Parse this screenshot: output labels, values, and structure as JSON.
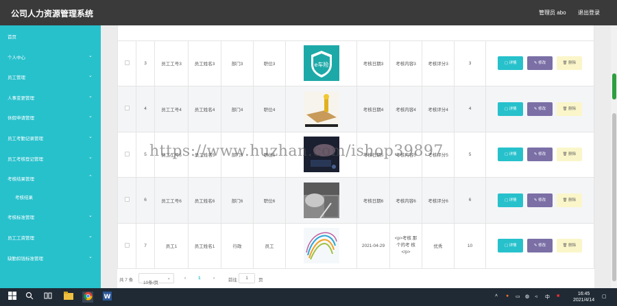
{
  "app": {
    "title": "公司人力资源管理系统",
    "user_label": "管理员 abo",
    "logout_label": "退出登录"
  },
  "sidebar": {
    "items": [
      {
        "label": "首页",
        "chevron": ""
      },
      {
        "label": "个人中心",
        "chevron": "⌄"
      },
      {
        "label": "员工管理",
        "chevron": "⌄"
      },
      {
        "label": "人事变更管理",
        "chevron": "⌄"
      },
      {
        "label": "休假申请管理",
        "chevron": "⌄"
      },
      {
        "label": "员工考勤记录管理",
        "chevron": "⌄"
      },
      {
        "label": "员工考核登记管理",
        "chevron": "⌄"
      },
      {
        "label": "考核结果管理",
        "chevron": "⌃"
      },
      {
        "label": "考核结果",
        "chevron": ""
      },
      {
        "label": "考核标准管理",
        "chevron": "⌄"
      },
      {
        "label": "员工工资管理",
        "chevron": "⌄"
      },
      {
        "label": "缺勤扣钱标准管理",
        "chevron": "⌄"
      }
    ]
  },
  "table": {
    "rows": [
      {
        "no": "3",
        "emp_id": "员工工号3",
        "emp_name": "员工姓名3",
        "dept": "部门3",
        "position": "职位3",
        "photo": "car-insurance-logo",
        "date": "考核日期3",
        "content": "考核内容3",
        "score": "考核评分3",
        "value": "3"
      },
      {
        "no": "4",
        "emp_id": "员工工号4",
        "emp_name": "员工姓名4",
        "dept": "部门4",
        "position": "职位4",
        "photo": "gold-figurine-photo",
        "date": "考核日期4",
        "content": "考核内容4",
        "score": "考核评分4",
        "value": "4"
      },
      {
        "no": "5",
        "emp_id": "员工工号5",
        "emp_name": "员工姓名5",
        "dept": "部门5",
        "position": "职位5",
        "photo": "dark-hand-photo",
        "date": "考核日期5",
        "content": "考核内容5",
        "score": "考核评分5",
        "value": "5"
      },
      {
        "no": "6",
        "emp_id": "员工工号6",
        "emp_name": "员工姓名6",
        "dept": "部门6",
        "position": "职位6",
        "photo": "car-accident-photo",
        "date": "考核日期6",
        "content": "考核内容6",
        "score": "考核评分6",
        "value": "6"
      },
      {
        "no": "7",
        "emp_id": "员工1",
        "emp_name": "员工姓名1",
        "dept": "行政",
        "position": "员工",
        "photo": "colorful-swirl-image",
        "date": "2021-04-29",
        "content": "<p>考核 那个的考 核</p>",
        "score": "优秀",
        "value": "10"
      }
    ],
    "actions": {
      "detail": "详情",
      "edit": "修改",
      "delete": "删除"
    }
  },
  "pager": {
    "total": "共 7 条",
    "page_size": "10条/页",
    "prev": "‹",
    "current": "1",
    "next": "›",
    "goto_label": "前往",
    "goto_value": "1",
    "page_unit": "页"
  },
  "watermark": "https://www.huzhan.com/ishop39897",
  "taskbar": {
    "time": "16:45",
    "date": "2021/4/14",
    "ime": "中",
    "icons": [
      "windows-icon",
      "search-icon",
      "task-view-icon",
      "file-explorer-icon",
      "chrome-icon",
      "word-icon"
    ]
  },
  "colors": {
    "accent": "#27c1cc",
    "topbar": "#3a3a3a",
    "edit": "#7b6fa6",
    "delete": "#fbf6c9"
  }
}
